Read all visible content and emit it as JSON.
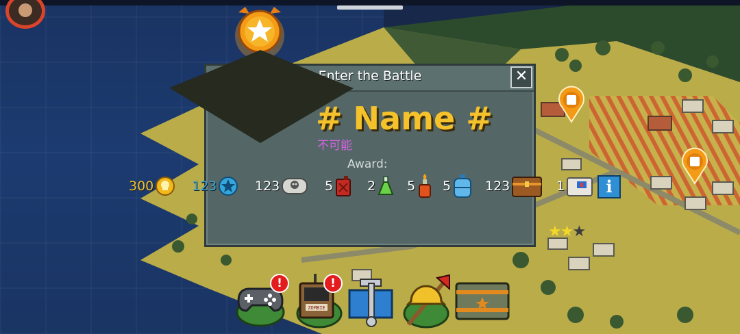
{
  "dialog": {
    "title": "Enter the Battle",
    "close_label": "✕",
    "name": "# Name #",
    "subtitle": "不可能",
    "award_label": "Award:"
  },
  "awards": [
    {
      "value": "300",
      "icon": "gold-skull-coin-icon",
      "color": "#f2c02a"
    },
    {
      "value": "123",
      "icon": "blue-star-icon",
      "color": "#35a6dd"
    },
    {
      "value": "123",
      "icon": "silver-skull-icon",
      "color": "#ffffff"
    },
    {
      "value": "5",
      "icon": "fuel-can-icon",
      "color": "#ffffff"
    },
    {
      "value": "2",
      "icon": "green-potion-icon",
      "color": "#ffffff"
    },
    {
      "value": "5",
      "icon": "molotov-bottle-icon",
      "color": "#ffffff"
    },
    {
      "value": "5",
      "icon": "water-jug-icon",
      "color": "#ffffff"
    },
    {
      "value": "123",
      "icon": "treasure-chest-icon",
      "color": "#ffffff"
    },
    {
      "value": "1",
      "icon": "medkit-box-icon",
      "color": "#ffffff"
    }
  ],
  "info_label": "i",
  "rating": {
    "filled": 2,
    "total": 3
  },
  "bottom_bar": [
    {
      "name": "gamepad-button",
      "icon": "gamepad-icon",
      "alert": "!"
    },
    {
      "name": "zombie-radio-button",
      "icon": "zombie-radio-icon",
      "alert": "!"
    },
    {
      "name": "workshop-button",
      "icon": "wrench-tools-icon"
    },
    {
      "name": "survivor-button",
      "icon": "hard-hat-axe-icon"
    },
    {
      "name": "supply-crate-button",
      "icon": "supply-crate-icon"
    }
  ],
  "colors": {
    "dialog_bg": "#546766",
    "name_gold": "#f5c22c",
    "subtitle_purple": "#d862e8",
    "map_yellow": "#bcb14a",
    "marker_orange": "#f39b17"
  }
}
